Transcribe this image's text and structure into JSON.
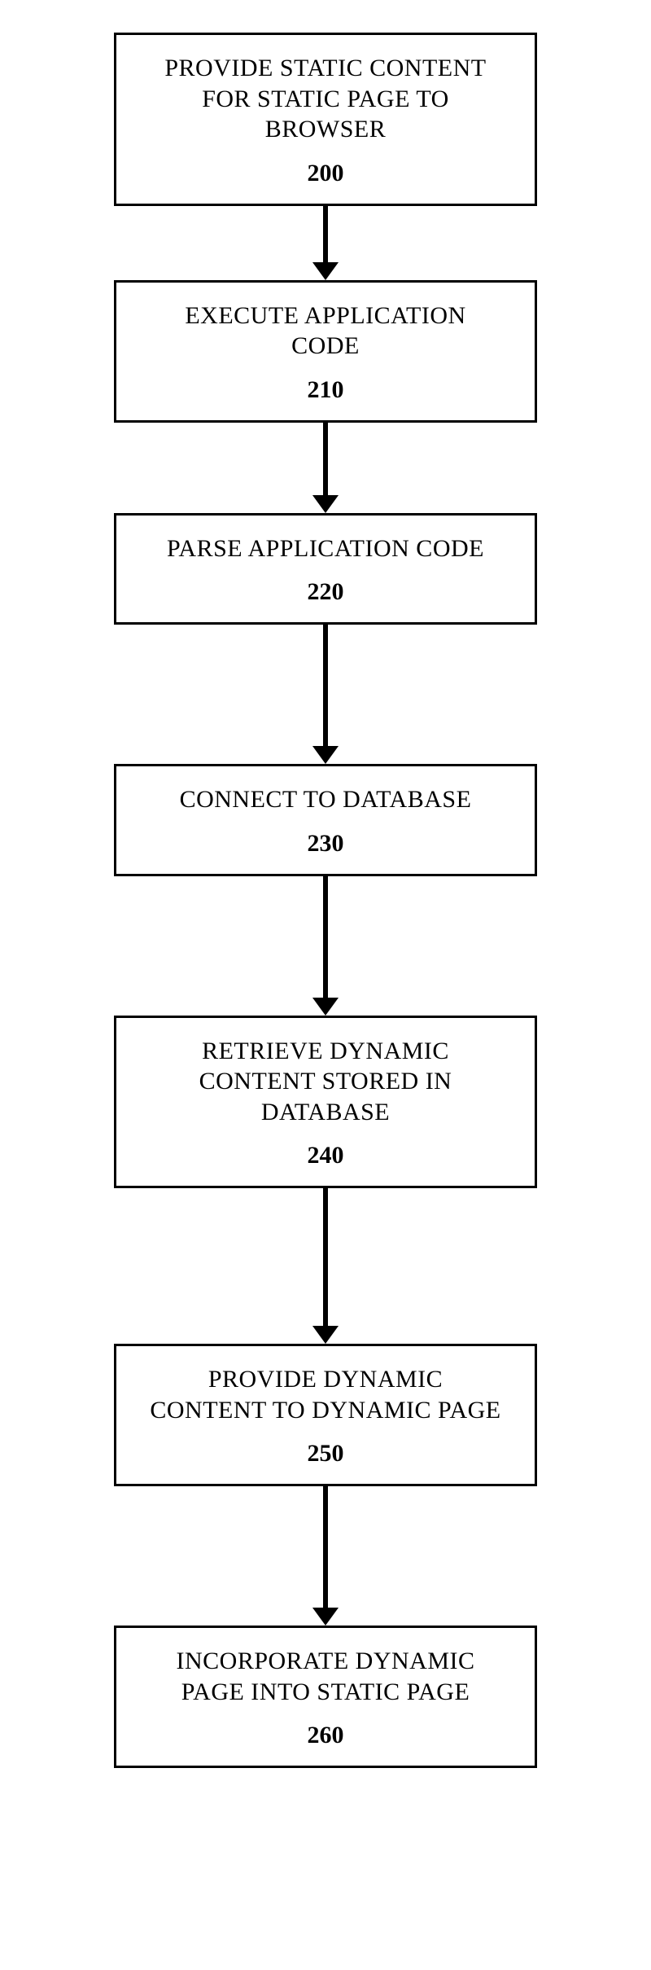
{
  "flowchart": {
    "steps": [
      {
        "text": "PROVIDE STATIC CONTENT FOR STATIC PAGE TO BROWSER",
        "number": "200",
        "arrowHeight": 70
      },
      {
        "text": "EXECUTE APPLICATION CODE",
        "number": "210",
        "arrowHeight": 90
      },
      {
        "text": "PARSE APPLICATION CODE",
        "number": "220",
        "arrowHeight": 150
      },
      {
        "text": "CONNECT TO DATABASE",
        "number": "230",
        "arrowHeight": 150
      },
      {
        "text": "RETRIEVE DYNAMIC CONTENT STORED IN DATABASE",
        "number": "240",
        "arrowHeight": 170
      },
      {
        "text": "PROVIDE DYNAMIC CONTENT TO DYNAMIC PAGE",
        "number": "250",
        "arrowHeight": 150
      },
      {
        "text": "INCORPORATE DYNAMIC PAGE INTO STATIC PAGE",
        "number": "260",
        "arrowHeight": null
      }
    ]
  }
}
